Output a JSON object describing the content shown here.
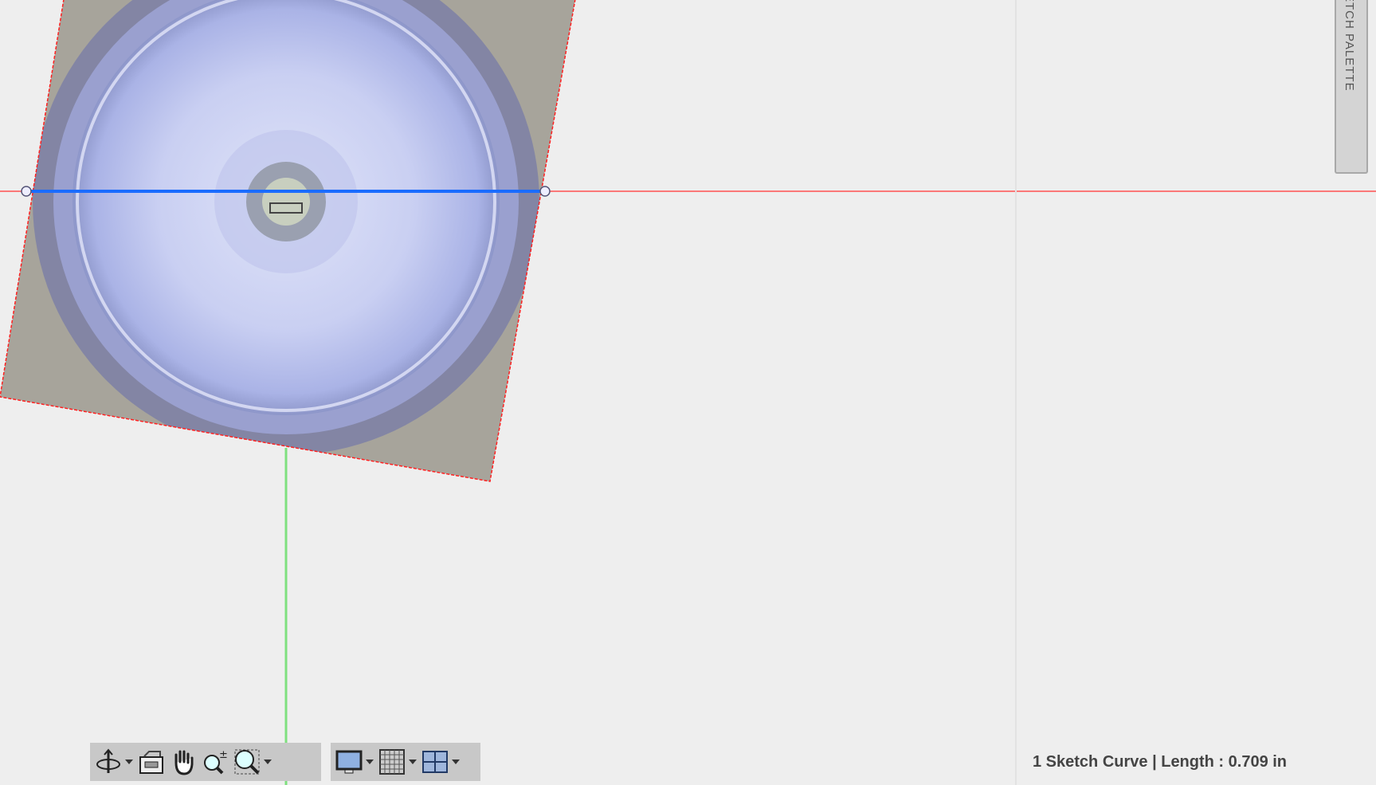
{
  "sketch_palette": {
    "label": "SKETCH PALETTE"
  },
  "status_bar": {
    "selection_info": "1 Sketch Curve | Length : 0.709 in"
  },
  "navigation_toolbar": {
    "items": [
      {
        "icon": "orbit-icon",
        "has_dropdown": true
      },
      {
        "icon": "look-at-icon",
        "has_dropdown": false
      },
      {
        "icon": "pan-hand-icon",
        "has_dropdown": false
      },
      {
        "icon": "zoom-icon",
        "has_dropdown": false
      },
      {
        "icon": "zoom-window-icon",
        "has_dropdown": true
      }
    ]
  },
  "display_toolbar": {
    "items": [
      {
        "icon": "display-settings-icon",
        "has_dropdown": true
      },
      {
        "icon": "grid-icon",
        "has_dropdown": true
      },
      {
        "icon": "viewports-icon",
        "has_dropdown": true
      }
    ]
  },
  "colors": {
    "x_axis": "#ff3b3b",
    "y_axis": "#7ee07e",
    "selected_curve": "#1a6cff",
    "background": "#eeeeee"
  }
}
